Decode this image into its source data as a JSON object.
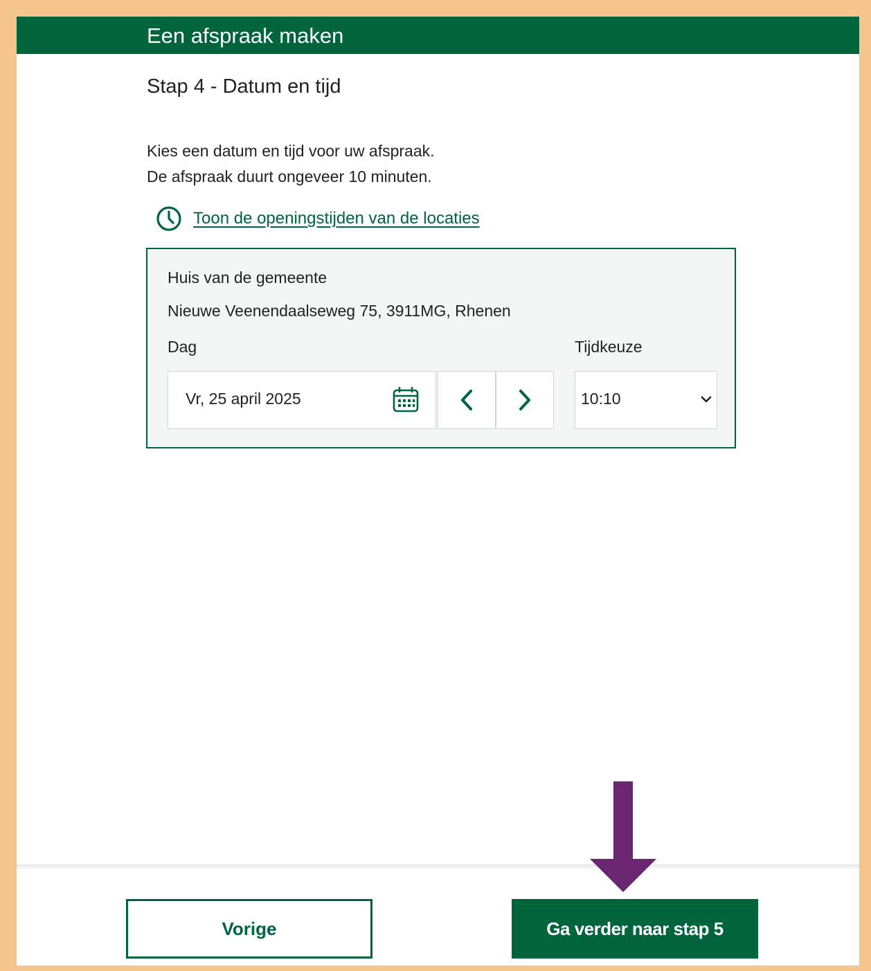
{
  "header": {
    "title": "Een afspraak maken"
  },
  "step": {
    "title": "Stap 4 - Datum en tijd"
  },
  "intro": {
    "line1": "Kies een datum en tijd voor uw afspraak.",
    "line2": "De afspraak duurt ongeveer 10 minuten."
  },
  "hours_link": {
    "icon": "clock-icon",
    "label": "Toon de openingstijden van de locaties"
  },
  "location": {
    "name": "Huis van de gemeente",
    "address": "Nieuwe Veenendaalseweg 75, 3911MG, Rhenen",
    "day_label": "Dag",
    "date_value": "Vr, 25 april 2025",
    "time_label": "Tijdkeuze",
    "time_value": "10:10"
  },
  "footer": {
    "prev_label": "Vorige",
    "next_label": "Ga verder naar stap 5"
  },
  "colors": {
    "brand_green": "#00643c",
    "card_background": "#f2f6f4",
    "page_border": "#f4c68d",
    "annotation_arrow": "#6b2671"
  }
}
